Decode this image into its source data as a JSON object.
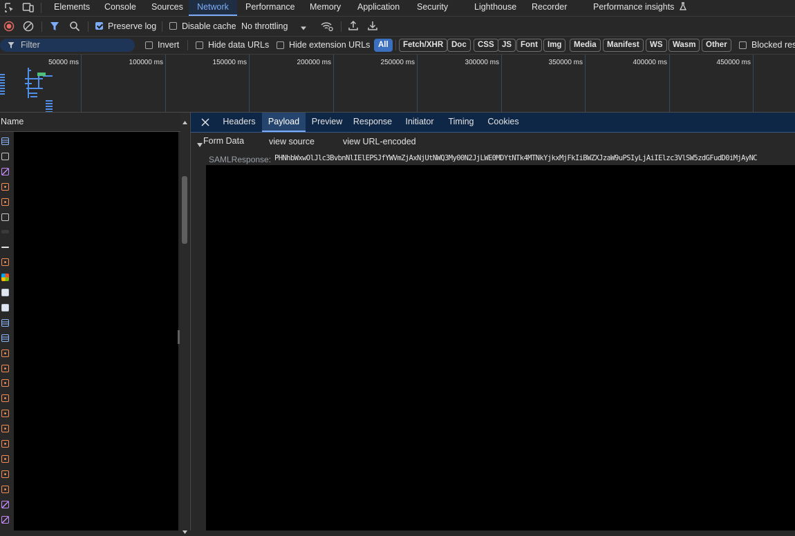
{
  "tabs": {
    "items": [
      "Elements",
      "Console",
      "Sources",
      "Network",
      "Performance",
      "Memory",
      "Application",
      "Security",
      "Lighthouse",
      "Recorder",
      "Performance insights"
    ],
    "active": "Network"
  },
  "toolbar": {
    "preserve_log": "Preserve log",
    "preserve_log_checked": true,
    "disable_cache": "Disable cache",
    "disable_cache_checked": false,
    "throttling": "No throttling"
  },
  "filterbar": {
    "filter_placeholder": "Filter",
    "invert": "Invert",
    "hide_data_urls": "Hide data URLs",
    "hide_extension_urls": "Hide extension URLs",
    "types": [
      "All",
      "Fetch/XHR",
      "Doc",
      "CSS",
      "JS",
      "Font",
      "Img",
      "Media",
      "Manifest",
      "WS",
      "Wasm",
      "Other"
    ],
    "active_type": "All",
    "blocked": "Blocked res"
  },
  "overview": {
    "ticks": [
      "50000 ms",
      "100000 ms",
      "150000 ms",
      "200000 ms",
      "250000 ms",
      "300000 ms",
      "350000 ms",
      "400000 ms",
      "450000 ms"
    ]
  },
  "request_list": {
    "header": "Name"
  },
  "detail": {
    "tabs": [
      "Headers",
      "Payload",
      "Preview",
      "Response",
      "Initiator",
      "Timing",
      "Cookies"
    ],
    "active_tab": "Payload",
    "section_title": "Form Data",
    "view_source": "view source",
    "view_url_encoded": "view URL-encoded",
    "field_name": "SAMLResponse:",
    "field_value": "PHNhbWxwOlJlc3BvbnNlIElEPSJfYWVmZjAxNjUtNWQ3My00N2JjLWE0MDYtNTk4MTNkYjkxMjFkIiBWZXJzaW9uPSIyLjAiIElzc3VlSW5zdGFudD0iMjAyNC"
  },
  "colors": {
    "accent": "#7cacf8",
    "record": "#e46962",
    "doc_icon": "#8ab4f8",
    "script_icon": "#f28b54",
    "media_icon": "#c58af9"
  }
}
